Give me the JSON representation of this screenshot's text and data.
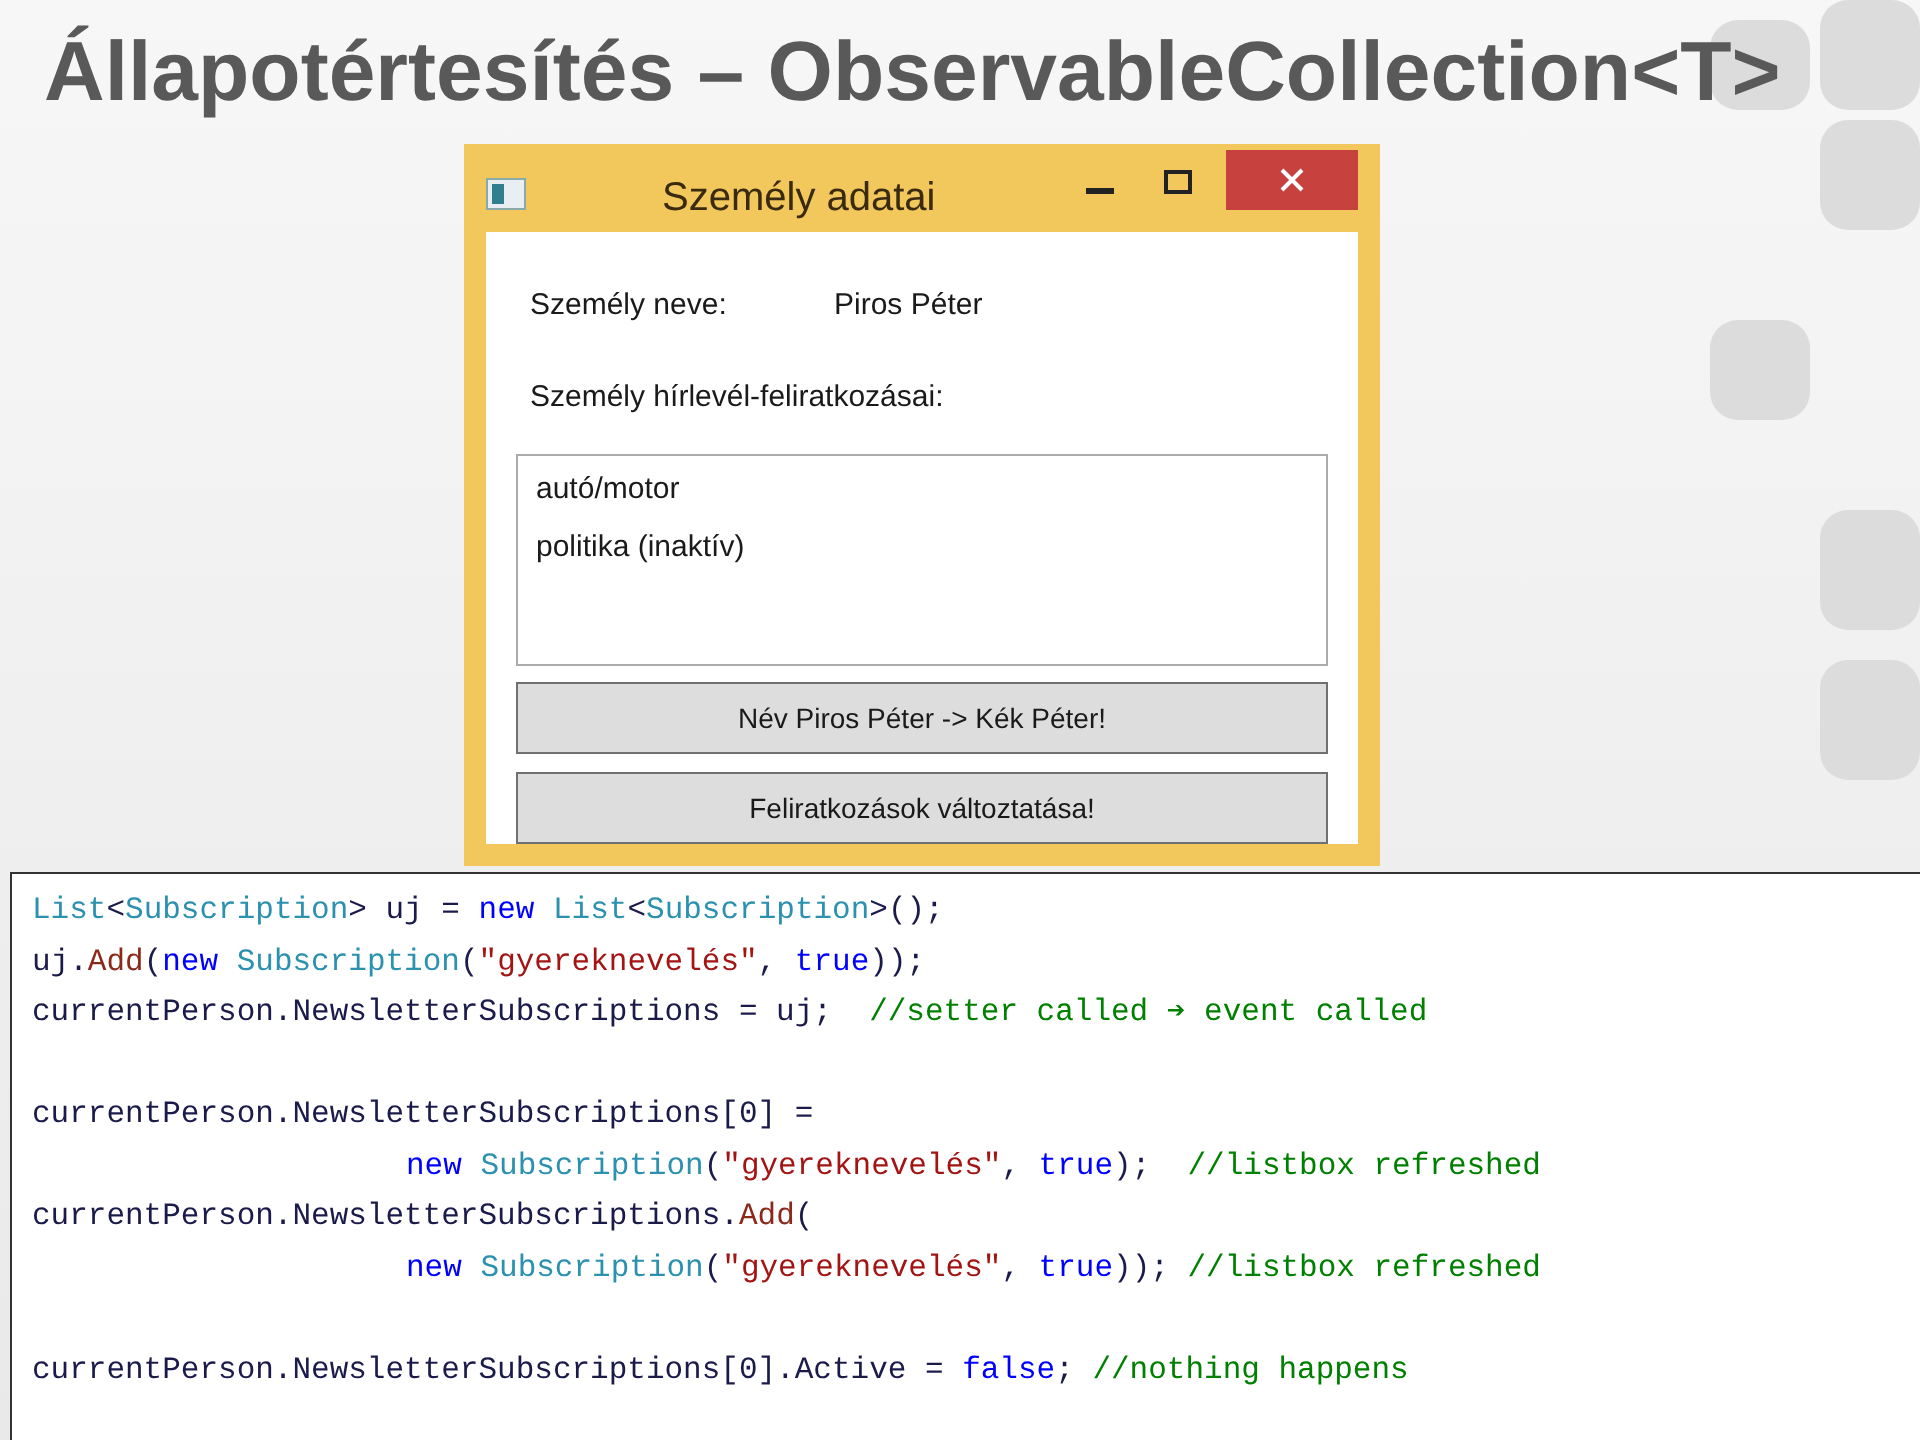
{
  "slide_title": "Állapotértesítés – ObservableCollection<T>",
  "window": {
    "title": "Személy adatai",
    "name_label": "Személy neve:",
    "name_value": "Piros Péter",
    "list_label": "Személy hírlevél-feliratkozásai:",
    "list_items": [
      "autó/motor",
      "politika (inaktív)"
    ],
    "buttons": [
      "Név Piros Péter -> Kék Péter!",
      "Feliratkozások változtatása!"
    ]
  },
  "code_lines": [
    {
      "kind": "code",
      "indent": false,
      "tokens": [
        {
          "kind": "type",
          "text": "List"
        },
        {
          "kind": "plain",
          "text": "<"
        },
        {
          "kind": "type",
          "text": "Subscription"
        },
        {
          "kind": "plain",
          "text": "> uj = "
        },
        {
          "kind": "keyword",
          "text": "new "
        },
        {
          "kind": "type",
          "text": "List"
        },
        {
          "kind": "plain",
          "text": "<"
        },
        {
          "kind": "type",
          "text": "Subscription"
        },
        {
          "kind": "plain",
          "text": ">();"
        }
      ]
    },
    {
      "kind": "code",
      "indent": false,
      "tokens": [
        {
          "kind": "plain",
          "text": "uj."
        },
        {
          "kind": "method",
          "text": "Add"
        },
        {
          "kind": "plain",
          "text": "("
        },
        {
          "kind": "keyword",
          "text": "new "
        },
        {
          "kind": "type",
          "text": "Subscription"
        },
        {
          "kind": "plain",
          "text": "("
        },
        {
          "kind": "string",
          "text": "\"gyereknevelés\""
        },
        {
          "kind": "plain",
          "text": ", "
        },
        {
          "kind": "keyword",
          "text": "true"
        },
        {
          "kind": "plain",
          "text": "));"
        }
      ]
    },
    {
      "kind": "code",
      "indent": false,
      "tokens": [
        {
          "kind": "plain",
          "text": "currentPerson.NewsletterSubscriptions = uj;  "
        },
        {
          "kind": "comment",
          "text": "//setter called ➔ event called"
        }
      ]
    },
    {
      "kind": "blank"
    },
    {
      "kind": "code",
      "indent": false,
      "tokens": [
        {
          "kind": "plain",
          "text": "currentPerson.NewsletterSubscriptions[0] ="
        }
      ]
    },
    {
      "kind": "code",
      "indent": true,
      "tokens": [
        {
          "kind": "keyword",
          "text": "new "
        },
        {
          "kind": "type",
          "text": "Subscription"
        },
        {
          "kind": "plain",
          "text": "("
        },
        {
          "kind": "string",
          "text": "\"gyereknevelés\""
        },
        {
          "kind": "plain",
          "text": ", "
        },
        {
          "kind": "keyword",
          "text": "true"
        },
        {
          "kind": "plain",
          "text": ");  "
        },
        {
          "kind": "comment",
          "text": "//listbox refreshed"
        }
      ]
    },
    {
      "kind": "code",
      "indent": false,
      "tokens": [
        {
          "kind": "plain",
          "text": "currentPerson.NewsletterSubscriptions."
        },
        {
          "kind": "method",
          "text": "Add"
        },
        {
          "kind": "plain",
          "text": "("
        }
      ]
    },
    {
      "kind": "code",
      "indent": true,
      "tokens": [
        {
          "kind": "keyword",
          "text": "new "
        },
        {
          "kind": "type",
          "text": "Subscription"
        },
        {
          "kind": "plain",
          "text": "("
        },
        {
          "kind": "string",
          "text": "\"gyereknevelés\""
        },
        {
          "kind": "plain",
          "text": ", "
        },
        {
          "kind": "keyword",
          "text": "true"
        },
        {
          "kind": "plain",
          "text": ")); "
        },
        {
          "kind": "comment",
          "text": "//listbox refreshed"
        }
      ]
    },
    {
      "kind": "blank"
    },
    {
      "kind": "code",
      "indent": false,
      "tokens": [
        {
          "kind": "plain",
          "text": "currentPerson.NewsletterSubscriptions[0].Active = "
        },
        {
          "kind": "keyword",
          "text": "false"
        },
        {
          "kind": "plain",
          "text": "; "
        },
        {
          "kind": "comment",
          "text": "//nothing happens"
        }
      ]
    }
  ]
}
